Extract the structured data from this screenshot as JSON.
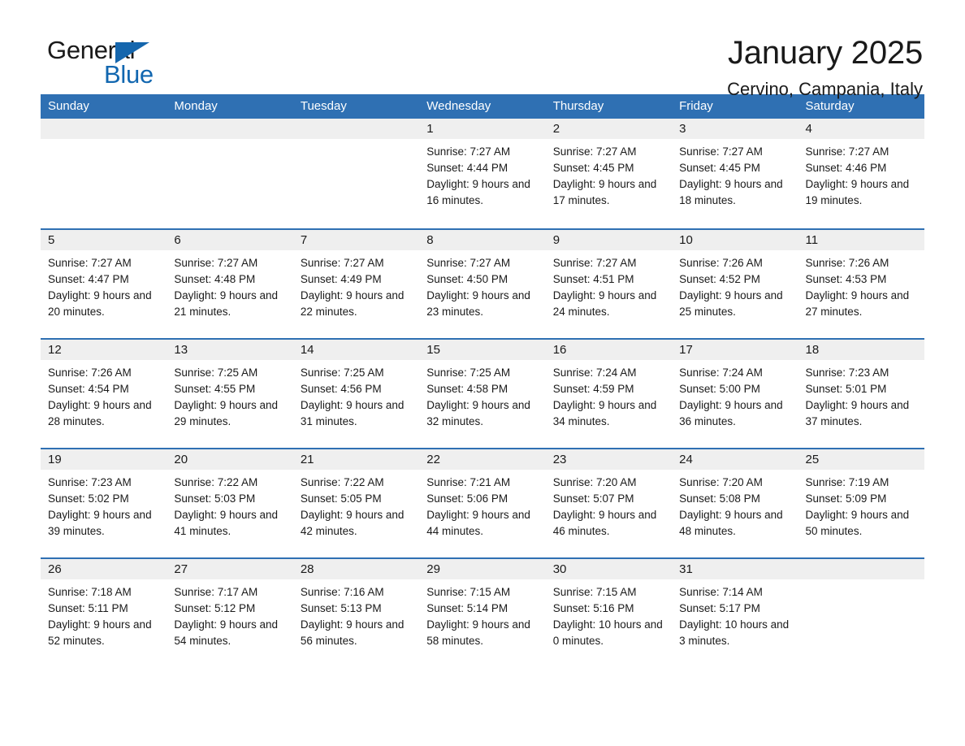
{
  "logo": {
    "word_one": "General",
    "word_two": "Blue",
    "triangle_color": "#1566ad",
    "blue_text_color": "#1267b0"
  },
  "header": {
    "title": "January 2025",
    "subtitle": "Cervino, Campania, Italy"
  },
  "theme": {
    "header_blue": "#2f70b3",
    "daynum_band": "#efefef",
    "text": "#1a1a1a"
  },
  "weekdays": [
    "Sunday",
    "Monday",
    "Tuesday",
    "Wednesday",
    "Thursday",
    "Friday",
    "Saturday"
  ],
  "weeks": [
    [
      {
        "day": "",
        "sunrise": "",
        "sunset": "",
        "daylight": ""
      },
      {
        "day": "",
        "sunrise": "",
        "sunset": "",
        "daylight": ""
      },
      {
        "day": "",
        "sunrise": "",
        "sunset": "",
        "daylight": ""
      },
      {
        "day": "1",
        "sunrise": "Sunrise: 7:27 AM",
        "sunset": "Sunset: 4:44 PM",
        "daylight": "Daylight: 9 hours and 16 minutes."
      },
      {
        "day": "2",
        "sunrise": "Sunrise: 7:27 AM",
        "sunset": "Sunset: 4:45 PM",
        "daylight": "Daylight: 9 hours and 17 minutes."
      },
      {
        "day": "3",
        "sunrise": "Sunrise: 7:27 AM",
        "sunset": "Sunset: 4:45 PM",
        "daylight": "Daylight: 9 hours and 18 minutes."
      },
      {
        "day": "4",
        "sunrise": "Sunrise: 7:27 AM",
        "sunset": "Sunset: 4:46 PM",
        "daylight": "Daylight: 9 hours and 19 minutes."
      }
    ],
    [
      {
        "day": "5",
        "sunrise": "Sunrise: 7:27 AM",
        "sunset": "Sunset: 4:47 PM",
        "daylight": "Daylight: 9 hours and 20 minutes."
      },
      {
        "day": "6",
        "sunrise": "Sunrise: 7:27 AM",
        "sunset": "Sunset: 4:48 PM",
        "daylight": "Daylight: 9 hours and 21 minutes."
      },
      {
        "day": "7",
        "sunrise": "Sunrise: 7:27 AM",
        "sunset": "Sunset: 4:49 PM",
        "daylight": "Daylight: 9 hours and 22 minutes."
      },
      {
        "day": "8",
        "sunrise": "Sunrise: 7:27 AM",
        "sunset": "Sunset: 4:50 PM",
        "daylight": "Daylight: 9 hours and 23 minutes."
      },
      {
        "day": "9",
        "sunrise": "Sunrise: 7:27 AM",
        "sunset": "Sunset: 4:51 PM",
        "daylight": "Daylight: 9 hours and 24 minutes."
      },
      {
        "day": "10",
        "sunrise": "Sunrise: 7:26 AM",
        "sunset": "Sunset: 4:52 PM",
        "daylight": "Daylight: 9 hours and 25 minutes."
      },
      {
        "day": "11",
        "sunrise": "Sunrise: 7:26 AM",
        "sunset": "Sunset: 4:53 PM",
        "daylight": "Daylight: 9 hours and 27 minutes."
      }
    ],
    [
      {
        "day": "12",
        "sunrise": "Sunrise: 7:26 AM",
        "sunset": "Sunset: 4:54 PM",
        "daylight": "Daylight: 9 hours and 28 minutes."
      },
      {
        "day": "13",
        "sunrise": "Sunrise: 7:25 AM",
        "sunset": "Sunset: 4:55 PM",
        "daylight": "Daylight: 9 hours and 29 minutes."
      },
      {
        "day": "14",
        "sunrise": "Sunrise: 7:25 AM",
        "sunset": "Sunset: 4:56 PM",
        "daylight": "Daylight: 9 hours and 31 minutes."
      },
      {
        "day": "15",
        "sunrise": "Sunrise: 7:25 AM",
        "sunset": "Sunset: 4:58 PM",
        "daylight": "Daylight: 9 hours and 32 minutes."
      },
      {
        "day": "16",
        "sunrise": "Sunrise: 7:24 AM",
        "sunset": "Sunset: 4:59 PM",
        "daylight": "Daylight: 9 hours and 34 minutes."
      },
      {
        "day": "17",
        "sunrise": "Sunrise: 7:24 AM",
        "sunset": "Sunset: 5:00 PM",
        "daylight": "Daylight: 9 hours and 36 minutes."
      },
      {
        "day": "18",
        "sunrise": "Sunrise: 7:23 AM",
        "sunset": "Sunset: 5:01 PM",
        "daylight": "Daylight: 9 hours and 37 minutes."
      }
    ],
    [
      {
        "day": "19",
        "sunrise": "Sunrise: 7:23 AM",
        "sunset": "Sunset: 5:02 PM",
        "daylight": "Daylight: 9 hours and 39 minutes."
      },
      {
        "day": "20",
        "sunrise": "Sunrise: 7:22 AM",
        "sunset": "Sunset: 5:03 PM",
        "daylight": "Daylight: 9 hours and 41 minutes."
      },
      {
        "day": "21",
        "sunrise": "Sunrise: 7:22 AM",
        "sunset": "Sunset: 5:05 PM",
        "daylight": "Daylight: 9 hours and 42 minutes."
      },
      {
        "day": "22",
        "sunrise": "Sunrise: 7:21 AM",
        "sunset": "Sunset: 5:06 PM",
        "daylight": "Daylight: 9 hours and 44 minutes."
      },
      {
        "day": "23",
        "sunrise": "Sunrise: 7:20 AM",
        "sunset": "Sunset: 5:07 PM",
        "daylight": "Daylight: 9 hours and 46 minutes."
      },
      {
        "day": "24",
        "sunrise": "Sunrise: 7:20 AM",
        "sunset": "Sunset: 5:08 PM",
        "daylight": "Daylight: 9 hours and 48 minutes."
      },
      {
        "day": "25",
        "sunrise": "Sunrise: 7:19 AM",
        "sunset": "Sunset: 5:09 PM",
        "daylight": "Daylight: 9 hours and 50 minutes."
      }
    ],
    [
      {
        "day": "26",
        "sunrise": "Sunrise: 7:18 AM",
        "sunset": "Sunset: 5:11 PM",
        "daylight": "Daylight: 9 hours and 52 minutes."
      },
      {
        "day": "27",
        "sunrise": "Sunrise: 7:17 AM",
        "sunset": "Sunset: 5:12 PM",
        "daylight": "Daylight: 9 hours and 54 minutes."
      },
      {
        "day": "28",
        "sunrise": "Sunrise: 7:16 AM",
        "sunset": "Sunset: 5:13 PM",
        "daylight": "Daylight: 9 hours and 56 minutes."
      },
      {
        "day": "29",
        "sunrise": "Sunrise: 7:15 AM",
        "sunset": "Sunset: 5:14 PM",
        "daylight": "Daylight: 9 hours and 58 minutes."
      },
      {
        "day": "30",
        "sunrise": "Sunrise: 7:15 AM",
        "sunset": "Sunset: 5:16 PM",
        "daylight": "Daylight: 10 hours and 0 minutes."
      },
      {
        "day": "31",
        "sunrise": "Sunrise: 7:14 AM",
        "sunset": "Sunset: 5:17 PM",
        "daylight": "Daylight: 10 hours and 3 minutes."
      },
      {
        "day": "",
        "sunrise": "",
        "sunset": "",
        "daylight": ""
      }
    ]
  ]
}
